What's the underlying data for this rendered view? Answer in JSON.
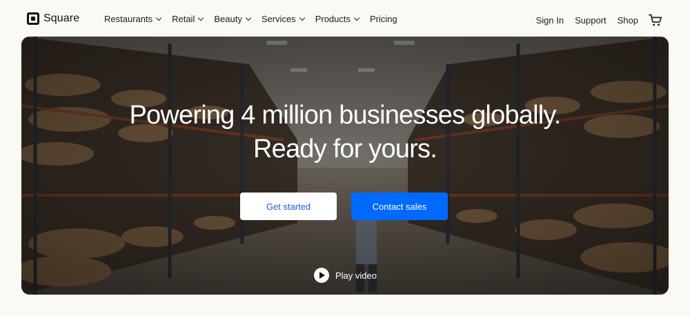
{
  "brand": {
    "name": "Square"
  },
  "nav": {
    "menu": [
      {
        "label": "Restaurants",
        "dropdown": true
      },
      {
        "label": "Retail",
        "dropdown": true
      },
      {
        "label": "Beauty",
        "dropdown": true
      },
      {
        "label": "Services",
        "dropdown": true
      },
      {
        "label": "Products",
        "dropdown": true
      },
      {
        "label": "Pricing",
        "dropdown": false
      }
    ],
    "right": {
      "sign_in": "Sign In",
      "support": "Support",
      "shop": "Shop"
    },
    "cart_icon": "shopping-cart-icon"
  },
  "hero": {
    "title_line1": "Powering 4 million businesses globally.",
    "title_line2": "Ready for yours.",
    "primary_cta": "Get started",
    "secondary_cta": "Contact sales",
    "play_label": "Play video",
    "play_icon": "play-icon",
    "background": "warehouse-photo"
  },
  "colors": {
    "page_bg": "#fbf9f4",
    "accent": "#006aff",
    "primary_cta_text": "#1d5bd8"
  }
}
